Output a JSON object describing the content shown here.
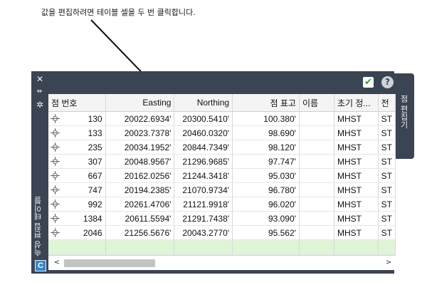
{
  "callout": {
    "text": "값을 편집하려면 테이블 셀을 두 번 클릭합니다."
  },
  "palette": {
    "side_title": "속성 편집 테이블",
    "tab_label": "점 편집기",
    "close_glyph": "✕",
    "autohide_glyph": "⇷",
    "props_glyph": "✲",
    "app_logo_letter": "C",
    "apply_glyph": "✔",
    "help_glyph": "?"
  },
  "table": {
    "columns": [
      "점 번호",
      "Easting",
      "Northing",
      "점 표고",
      "이름",
      "초기 정...",
      "전"
    ],
    "rows": [
      {
        "number": "130",
        "easting": "20022.6934'",
        "northing": "20300.5410'",
        "elevation": "100.380'",
        "name": "",
        "raw": "MHST",
        "full": "ST"
      },
      {
        "number": "133",
        "easting": "20023.7378'",
        "northing": "20460.0320'",
        "elevation": "98.690'",
        "name": "",
        "raw": "MHST",
        "full": "ST"
      },
      {
        "number": "235",
        "easting": "20034.1952'",
        "northing": "20844.7349'",
        "elevation": "98.120'",
        "name": "",
        "raw": "MHST",
        "full": "ST"
      },
      {
        "number": "307",
        "easting": "20048.9567'",
        "northing": "21296.9685'",
        "elevation": "97.747'",
        "name": "",
        "raw": "MHST",
        "full": "ST"
      },
      {
        "number": "667",
        "easting": "20162.0256'",
        "northing": "21244.3418'",
        "elevation": "95.030'",
        "name": "",
        "raw": "MHST",
        "full": "ST"
      },
      {
        "number": "747",
        "easting": "20194.2385'",
        "northing": "21070.9734'",
        "elevation": "96.780'",
        "name": "",
        "raw": "MHST",
        "full": "ST"
      },
      {
        "number": "992",
        "easting": "20261.4706'",
        "northing": "21121.9918'",
        "elevation": "96.020'",
        "name": "",
        "raw": "MHST",
        "full": "ST"
      },
      {
        "number": "1384",
        "easting": "20611.5594'",
        "northing": "21291.7438'",
        "elevation": "93.090'",
        "name": "",
        "raw": "MHST",
        "full": "ST"
      },
      {
        "number": "2046",
        "easting": "21256.5676'",
        "northing": "20043.2770'",
        "elevation": "95.562'",
        "name": "",
        "raw": "MHST",
        "full": "ST"
      }
    ]
  },
  "scrollbar": {
    "left_arrow": "<",
    "right_arrow": ">"
  },
  "colors": {
    "palette_bg": "#3b4453",
    "new_row_bg": "#dff5d8",
    "apply_check": "#2ca02c",
    "logo_bg": "#3a84c6"
  }
}
